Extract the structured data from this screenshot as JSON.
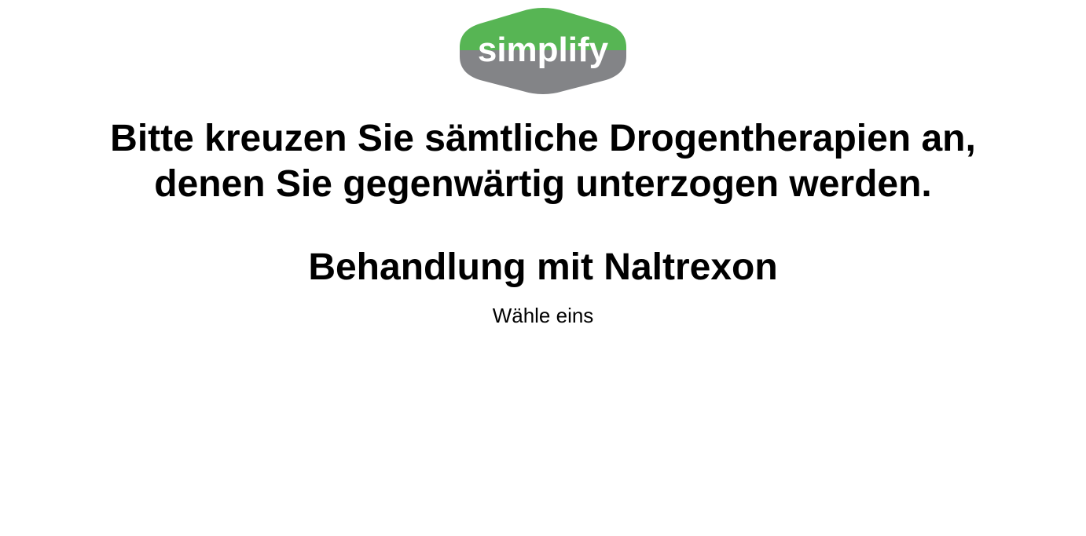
{
  "logo": {
    "text": "simplify",
    "top_color": "#57b554",
    "bottom_color": "#838487",
    "text_color": "#ffffff"
  },
  "question": {
    "line1": "Bitte kreuzen Sie sämtliche Drogentherapien an,",
    "line2": "denen Sie gegenwärtig unterzogen werden."
  },
  "option": {
    "title": "Behandlung mit Naltrexon",
    "instruction": "Wähle eins"
  }
}
